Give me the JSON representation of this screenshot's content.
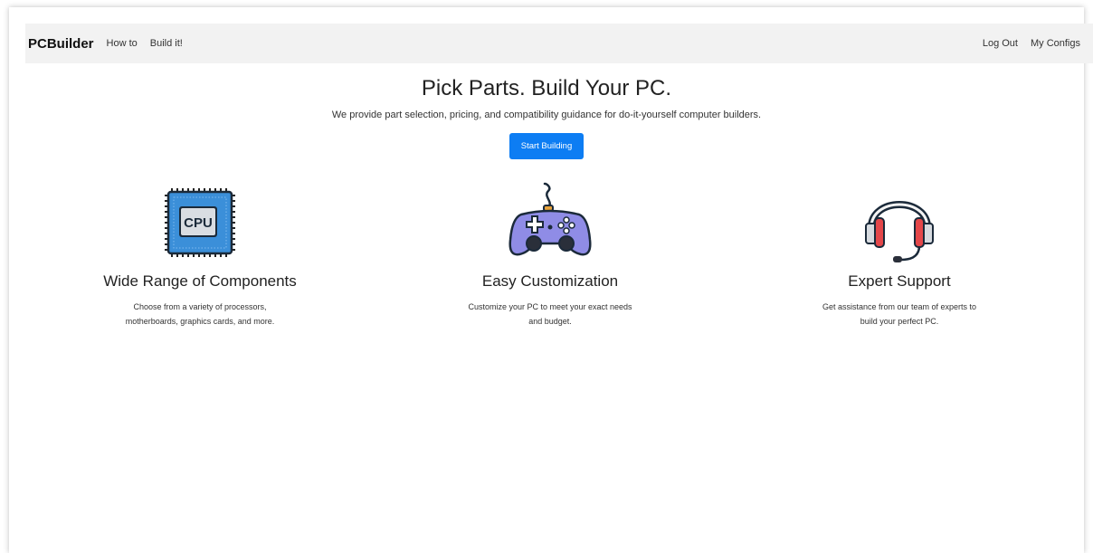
{
  "navbar": {
    "brand": "PCBuilder",
    "left_links": [
      "How to",
      "Build it!"
    ],
    "right_links": [
      "Log Out",
      "My Configs"
    ]
  },
  "hero": {
    "title": "Pick Parts. Build Your PC.",
    "subtitle": "We provide part selection, pricing, and compatibility guidance for do-it-yourself computer builders.",
    "cta_label": "Start Building"
  },
  "features": [
    {
      "icon": "cpu-icon",
      "title": "Wide Range of Components",
      "description": "Choose from a variety of processors, motherboards, graphics cards, and more."
    },
    {
      "icon": "gamepad-icon",
      "title": "Easy Customization",
      "description": "Customize your PC to meet your exact needs and budget."
    },
    {
      "icon": "headset-icon",
      "title": "Expert Support",
      "description": "Get assistance from our team of experts to build your perfect PC."
    }
  ],
  "colors": {
    "primary": "#0d7df3",
    "navbar_bg": "#f2f2f2",
    "cpu_blue": "#3b8fd9",
    "gamepad_purple": "#8f8ce6",
    "headset_red": "#e4474a"
  }
}
